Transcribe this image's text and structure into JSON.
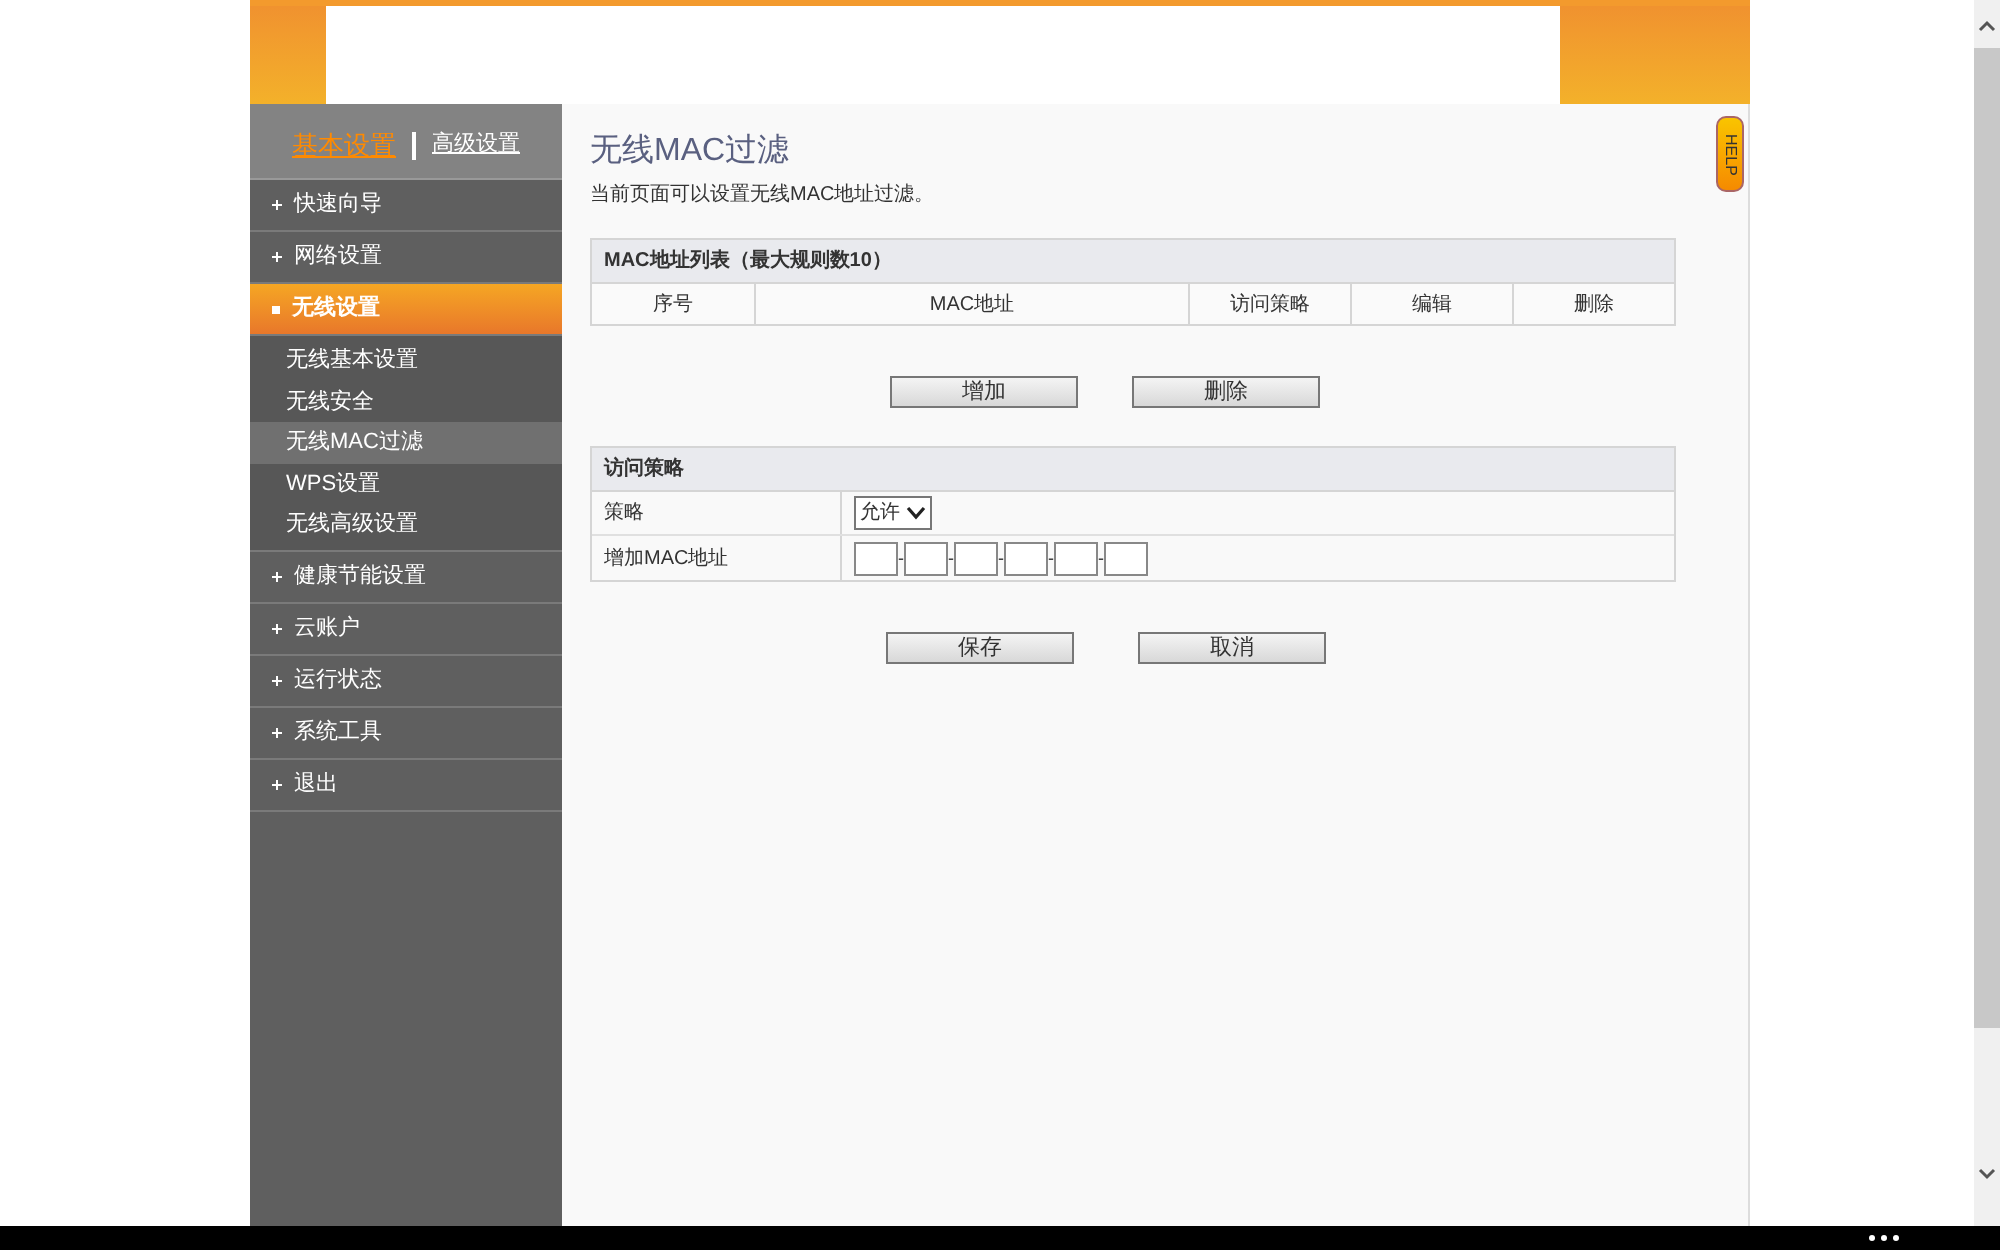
{
  "sidebar": {
    "tabs": [
      {
        "label": "基本设置",
        "selected": true
      },
      {
        "label": "高级设置",
        "selected": false
      }
    ],
    "items": [
      {
        "label": "快速向导",
        "expanded": false,
        "selected": false
      },
      {
        "label": "网络设置",
        "expanded": false,
        "selected": false
      },
      {
        "label": "无线设置",
        "expanded": true,
        "selected": true,
        "children": [
          {
            "label": "无线基本设置",
            "selected": false
          },
          {
            "label": "无线安全",
            "selected": false
          },
          {
            "label": "无线MAC过滤",
            "selected": true
          },
          {
            "label": "WPS设置",
            "selected": false
          },
          {
            "label": "无线高级设置",
            "selected": false
          }
        ]
      },
      {
        "label": "健康节能设置",
        "expanded": false,
        "selected": false
      },
      {
        "label": "云账户",
        "expanded": false,
        "selected": false
      },
      {
        "label": "运行状态",
        "expanded": false,
        "selected": false
      },
      {
        "label": "系统工具",
        "expanded": false,
        "selected": false
      },
      {
        "label": "退出",
        "expanded": false,
        "selected": false
      }
    ]
  },
  "page": {
    "title": "无线MAC过滤",
    "description": "当前页面可以设置无线MAC地址过滤。",
    "help": "HELP"
  },
  "mac_table": {
    "title": "MAC地址列表（最大规则数10）",
    "columns": [
      "序号",
      "MAC地址",
      "访问策略",
      "编辑",
      "删除"
    ]
  },
  "table_buttons": [
    "增加",
    "删除"
  ],
  "policy_section": {
    "title": "访问策略",
    "policy_label": "策略",
    "policy_value": "允许",
    "mac_label": "增加MAC地址",
    "mac_separators": [
      "-",
      "-",
      "-",
      "-",
      "-"
    ]
  },
  "form_buttons": [
    "保存",
    "取消"
  ]
}
